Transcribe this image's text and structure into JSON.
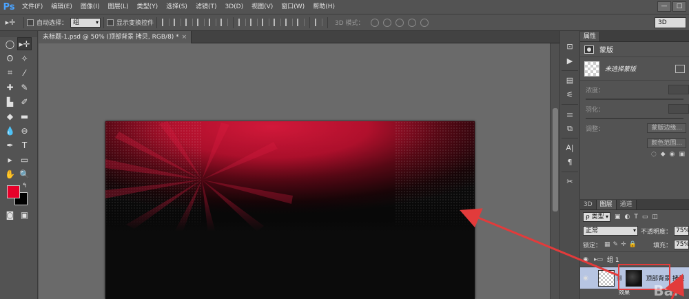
{
  "app": {
    "logo": "Ps",
    "menu": [
      "文件(F)",
      "编辑(E)",
      "图像(I)",
      "图层(L)",
      "类型(Y)",
      "选择(S)",
      "滤镜(T)",
      "3D(D)",
      "视图(V)",
      "窗口(W)",
      "帮助(H)"
    ],
    "window_buttons": [
      "—",
      "□"
    ]
  },
  "options_bar": {
    "tool_symbol": "▸✛",
    "auto_select_label": "自动选择：",
    "auto_select_value": "组",
    "show_transform_label": "显示变换控件",
    "mode_3d_label": "3D 模式：",
    "workspace": "3D"
  },
  "document": {
    "tab_title": "未标题-1.psd @ 50% (顶部背景 拷贝, RGB/8) *",
    "tab_close": "×"
  },
  "colors": {
    "foreground": "#e8002a",
    "background": "#000000",
    "canvas_red": "#c4102d",
    "annotation": "#e23b3b",
    "selected_layer": "#b7c5e2"
  },
  "properties_panel": {
    "tab": "属性",
    "title": "蒙版",
    "mask_label": "未选择蒙版",
    "density_label": "浓度：",
    "feather_label": "羽化：",
    "refine_label": "调整：",
    "mask_edge_button": "蒙版边缘...",
    "color_range_button": "颜色范围...",
    "bottom_icons": [
      "◌",
      "◆",
      "◉",
      "▣"
    ]
  },
  "layers_panel": {
    "tabs": [
      "3D",
      "图层",
      "通道"
    ],
    "filter_type": "ρ 类型",
    "filter_icons": [
      "▣",
      "◐",
      "T",
      "▭",
      "◫"
    ],
    "blend_mode": "正常",
    "opacity_label": "不透明度：",
    "opacity": "75%",
    "lock_label": "锁定：",
    "lock_icons": [
      "▦",
      "✎",
      "✛",
      "🔒"
    ],
    "fill_label": "填充：",
    "fill": "75%",
    "group_name": "组 1",
    "selected_layer_name": "顶部背景 拷贝",
    "next_layer_partial": "效果",
    "eye": "◉"
  },
  "watermark": "Bai"
}
